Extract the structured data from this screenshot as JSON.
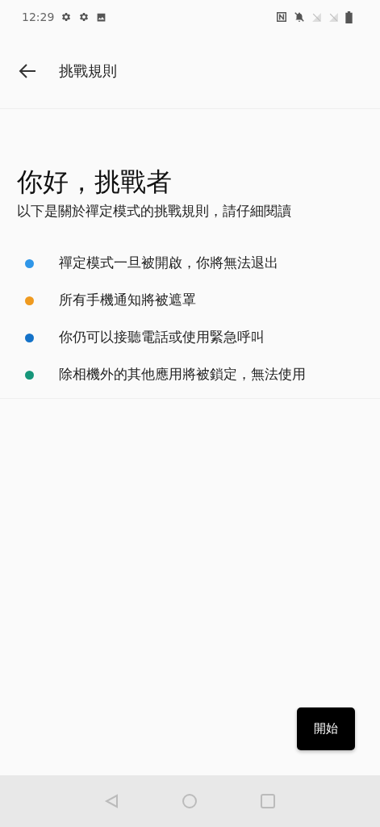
{
  "status_bar": {
    "time": "12:29"
  },
  "app_bar": {
    "title": "挑戰規則"
  },
  "heading": "你好，挑戰者",
  "subtitle": "以下是關於禪定模式的挑戰規則，請仔細閱讀",
  "rules": [
    {
      "text": "禪定模式一旦被開啟，你將無法退出",
      "color": "#2f96e8"
    },
    {
      "text": "所有手機通知將被遮罩",
      "color": "#ef9a1f"
    },
    {
      "text": "你仍可以接聽電話或使用緊急呼叫",
      "color": "#1472c8"
    },
    {
      "text": "除相機外的其他應用將被鎖定，無法使用",
      "color": "#16967a"
    }
  ],
  "start_button": {
    "label": "開始"
  }
}
